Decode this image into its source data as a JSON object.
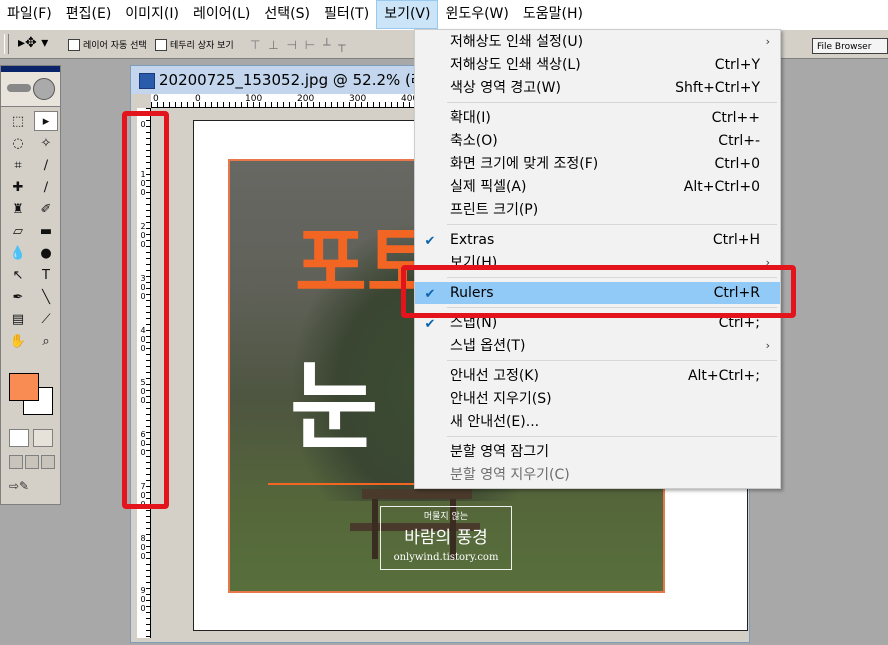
{
  "menubar": {
    "items": [
      "파일(F)",
      "편집(E)",
      "이미지(I)",
      "레이어(L)",
      "선택(S)",
      "필터(T)",
      "보기(V)",
      "윈도우(W)",
      "도움말(H)"
    ],
    "active_index": 6
  },
  "options_bar": {
    "auto_select_layer": "레이어 자동 선택",
    "show_bounding_box": "테두리 상자 보기",
    "file_browser": "File Browser"
  },
  "document": {
    "title": "20200725_153052.jpg @ 52.2% (레",
    "ruler_h_labels": [
      "0",
      "0",
      "100",
      "200",
      "300",
      "400"
    ],
    "ruler_v_labels": [
      "0",
      "100",
      "200",
      "300",
      "400",
      "500",
      "600",
      "700",
      "800",
      "900"
    ],
    "watermark": {
      "small": "머물지 않는",
      "main": "바람의 풍경",
      "url": "onlywind.tistory.com"
    },
    "headline_orange": "포토",
    "headline_white": "눈"
  },
  "colors": {
    "foreground": "#f98c52",
    "background": "#ffffff",
    "highlight": "#91c9f7",
    "annotation_red": "#e4141c"
  },
  "view_menu": {
    "items": [
      {
        "label": "저해상도 인쇄 설정(U)",
        "shortcut": "",
        "submenu": true
      },
      {
        "label": "저해상도 인쇄 색상(L)",
        "shortcut": "Ctrl+Y"
      },
      {
        "label": "색상 영역 경고(W)",
        "shortcut": "Shft+Ctrl+Y"
      },
      {
        "label": "확대(I)",
        "shortcut": "Ctrl++"
      },
      {
        "label": "축소(O)",
        "shortcut": "Ctrl+-"
      },
      {
        "label": "화면 크기에 맞게 조정(F)",
        "shortcut": "Ctrl+0"
      },
      {
        "label": "실제 픽셀(A)",
        "shortcut": "Alt+Ctrl+0"
      },
      {
        "label": "프린트 크기(P)",
        "shortcut": ""
      },
      {
        "label": "Extras",
        "shortcut": "Ctrl+H",
        "checked": true
      },
      {
        "label": "보기(H)",
        "shortcut": "",
        "submenu": true
      },
      {
        "label": "Rulers",
        "shortcut": "Ctrl+R",
        "checked": true,
        "highlighted": true
      },
      {
        "label": "스냅(N)",
        "shortcut": "Ctrl+;",
        "checked": true
      },
      {
        "label": "스냅 옵션(T)",
        "shortcut": "",
        "submenu": true
      },
      {
        "label": "안내선 고정(K)",
        "shortcut": "Alt+Ctrl+;"
      },
      {
        "label": "안내선 지우기(S)",
        "shortcut": ""
      },
      {
        "label": "새 안내선(E)...",
        "shortcut": ""
      },
      {
        "label": "분할 영역 잠그기",
        "shortcut": ""
      },
      {
        "label": "분할 영역 지우기(C)",
        "shortcut": "",
        "disabled": true
      }
    ]
  }
}
